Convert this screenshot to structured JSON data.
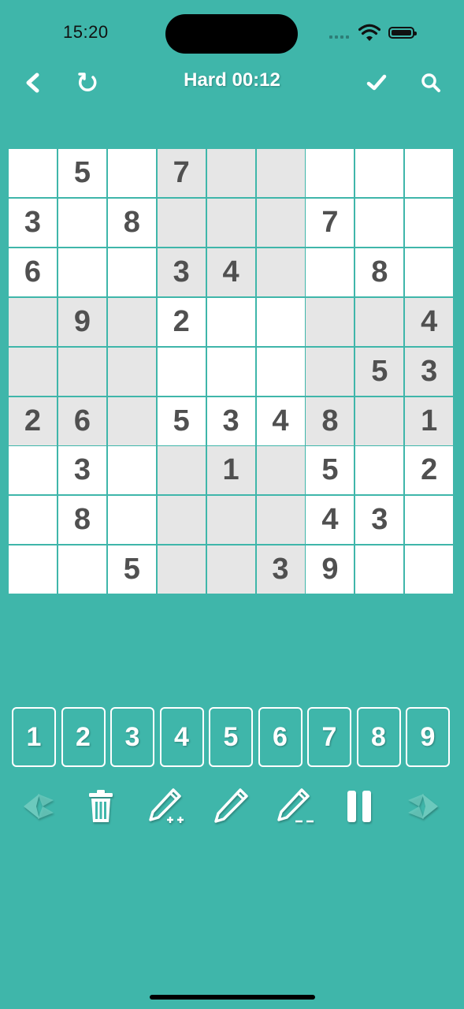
{
  "status_bar": {
    "time": "15:20"
  },
  "header": {
    "title": "Hard 00:12"
  },
  "board": {
    "rows": [
      [
        "",
        "5",
        "",
        "7",
        "",
        "",
        "",
        "",
        ""
      ],
      [
        "3",
        "",
        "8",
        "",
        "",
        "",
        "7",
        "",
        ""
      ],
      [
        "6",
        "",
        "",
        "3",
        "4",
        "",
        "",
        "8",
        ""
      ],
      [
        "",
        "9",
        "",
        "2",
        "",
        "",
        "",
        "",
        "4"
      ],
      [
        "",
        "",
        "",
        "",
        "",
        "",
        "",
        "5",
        "3"
      ],
      [
        "2",
        "6",
        "",
        "5",
        "3",
        "4",
        "8",
        "",
        "1"
      ],
      [
        "",
        "3",
        "",
        "",
        "1",
        "",
        "5",
        "",
        "2"
      ],
      [
        "",
        "8",
        "",
        "",
        "",
        "",
        "4",
        "3",
        ""
      ],
      [
        "",
        "",
        "5",
        "",
        "",
        "3",
        "9",
        "",
        ""
      ]
    ],
    "shaded": [
      [
        false,
        false,
        false,
        true,
        true,
        true,
        false,
        false,
        false
      ],
      [
        false,
        false,
        false,
        true,
        true,
        true,
        false,
        false,
        false
      ],
      [
        false,
        false,
        false,
        true,
        true,
        true,
        false,
        false,
        false
      ],
      [
        true,
        true,
        true,
        false,
        false,
        false,
        true,
        true,
        true
      ],
      [
        true,
        true,
        true,
        false,
        false,
        false,
        true,
        true,
        true
      ],
      [
        true,
        true,
        true,
        false,
        false,
        false,
        true,
        true,
        true
      ],
      [
        false,
        false,
        false,
        true,
        true,
        true,
        false,
        false,
        false
      ],
      [
        false,
        false,
        false,
        true,
        true,
        true,
        false,
        false,
        false
      ],
      [
        false,
        false,
        false,
        true,
        true,
        true,
        false,
        false,
        false
      ]
    ]
  },
  "number_pad": [
    "1",
    "2",
    "3",
    "4",
    "5",
    "6",
    "7",
    "8",
    "9"
  ],
  "toolbar": {
    "items": [
      "undo-arrow-icon",
      "trash-icon",
      "pencil-plus-icon",
      "pencil-icon",
      "pencil-minus-icon",
      "pause-icon",
      "redo-arrow-icon"
    ]
  },
  "colors": {
    "background": "#3fb6aa",
    "cell": "#ffffff",
    "cell_shaded": "#e6e6e6",
    "digit": "#505050"
  }
}
